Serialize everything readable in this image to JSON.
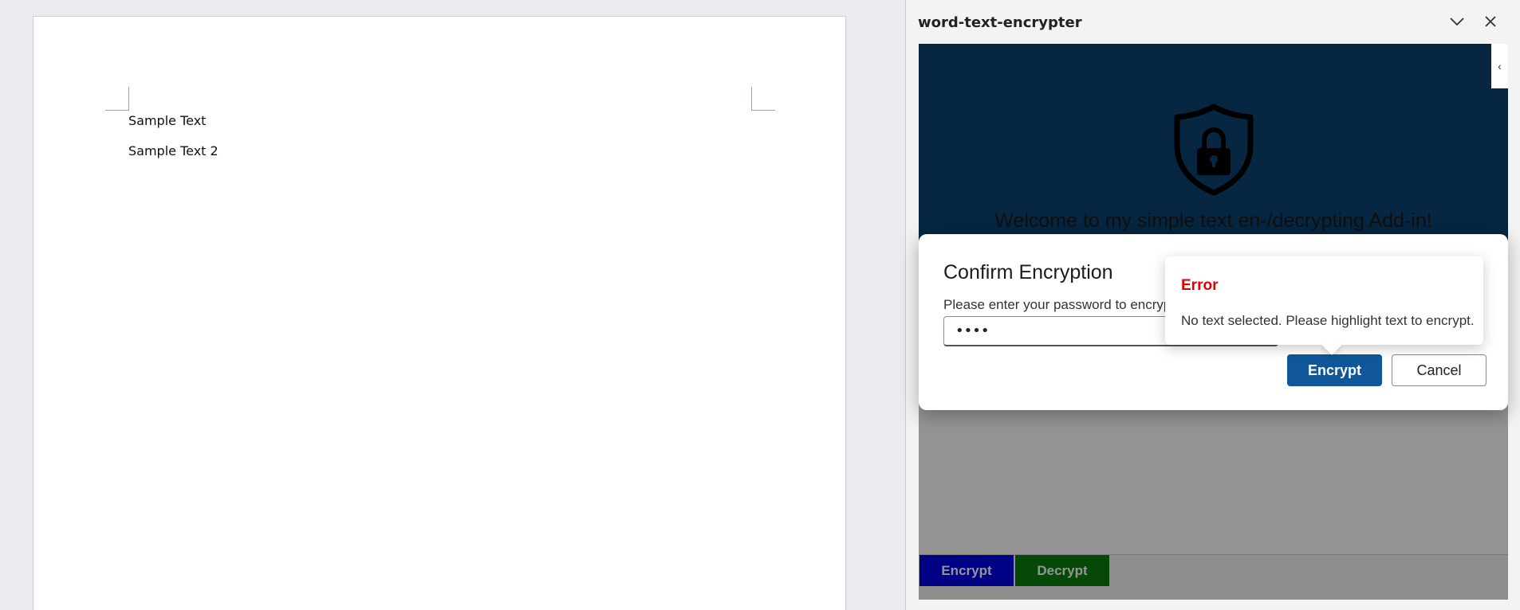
{
  "document": {
    "lines": [
      "Sample Text",
      "Sample Text 2"
    ]
  },
  "taskpane": {
    "title": "word-text-encrypter",
    "collapse_glyph": "‹",
    "welcome": "Welcome to my simple text en-/decrypting Add-in!",
    "hero_color": "#0b4271",
    "icons": {
      "hero": "shield-lock-icon",
      "header_left": "chevron-down-icon",
      "header_right": "close-icon"
    },
    "footer": {
      "encrypt_label": "Encrypt",
      "decrypt_label": "Decrypt",
      "encrypt_color": "#0000e6",
      "decrypt_color": "#0c7c0c"
    }
  },
  "dialog": {
    "title": "Confirm Encryption",
    "label": "Please enter your password to encrypt",
    "password_value": "••••",
    "primary_label": "Encrypt",
    "secondary_label": "Cancel",
    "primary_color": "#0f5799"
  },
  "callout": {
    "title": "Error",
    "message": "No text selected. Please highlight text to encrypt.",
    "title_color": "#e00000"
  }
}
